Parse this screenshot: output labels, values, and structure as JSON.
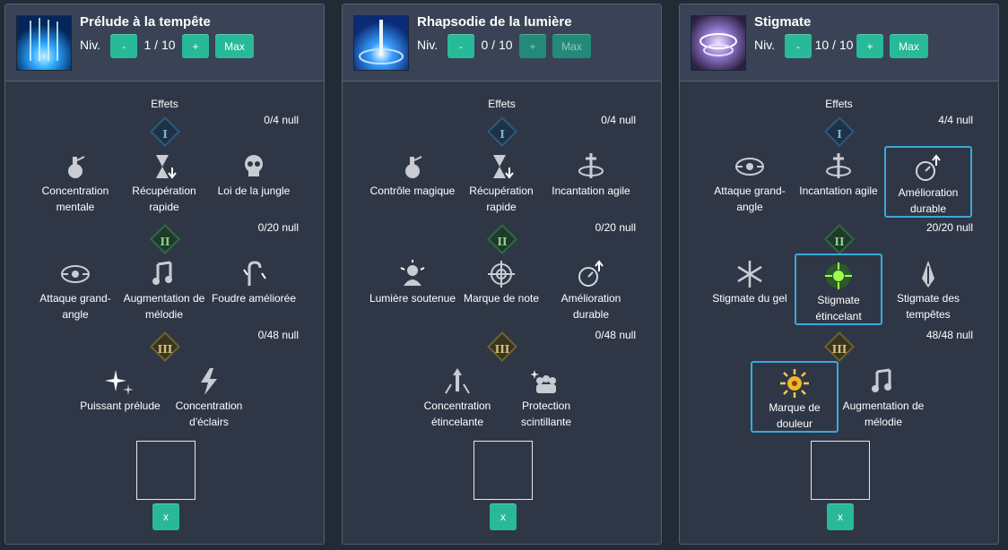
{
  "level_label": "Niv.",
  "minus_label": "-",
  "plus_label": "+",
  "max_label": "Max",
  "effects_label": "Effets",
  "remove_label": "x",
  "colors": {
    "button": "#28b998",
    "selected_border": "#3aa9d9",
    "panel": "#2f3747"
  },
  "panels": [
    {
      "title": "Prélude à la tempête",
      "level": "1 / 10",
      "counts": [
        "0/4 null",
        "0/20 null",
        "0/48 null"
      ],
      "tier1": [
        {
          "label": "Concentration mentale",
          "icon": "potion-icon"
        },
        {
          "label": "Récupération rapide",
          "icon": "hourglass-icon"
        },
        {
          "label": "Loi de la jungle",
          "icon": "skull-icon"
        }
      ],
      "tier2": [
        {
          "label": "Attaque grand-angle",
          "icon": "wide-eye-icon"
        },
        {
          "label": "Augmentation de mélodie",
          "icon": "music-note-icon"
        },
        {
          "label": "Foudre améliorée",
          "icon": "lightning-cane-icon"
        }
      ],
      "tier3": [
        {
          "label": "Puissant prélude",
          "icon": "sparkle-icon"
        },
        {
          "label": "Concentration d'éclairs",
          "icon": "lightning-icon"
        }
      ]
    },
    {
      "title": "Rhapsodie de la lumière",
      "level": "0 / 10",
      "counts": [
        "0/4 null",
        "0/20 null",
        "0/48 null"
      ],
      "tier1": [
        {
          "label": "Contrôle magique",
          "icon": "potion-icon"
        },
        {
          "label": "Récupération rapide",
          "icon": "hourglass-icon"
        },
        {
          "label": "Incantation agile",
          "icon": "sword-swirl-icon"
        }
      ],
      "tier2": [
        {
          "label": "Lumière soutenue",
          "icon": "sun-figure-icon"
        },
        {
          "label": "Marque de note",
          "icon": "target-icon"
        },
        {
          "label": "Amélioration durable",
          "icon": "stopwatch-up-icon"
        }
      ],
      "tier3": [
        {
          "label": "Concentration étincelante",
          "icon": "burst-up-icon"
        },
        {
          "label": "Protection scintillante",
          "icon": "group-sparkle-icon"
        }
      ]
    },
    {
      "title": "Stigmate",
      "level": "10 / 10",
      "counts": [
        "4/4 null",
        "20/20 null",
        "48/48 null"
      ],
      "tier1": [
        {
          "label": "Attaque grand-angle",
          "icon": "wide-eye-icon"
        },
        {
          "label": "Incantation agile",
          "icon": "sword-swirl-icon"
        },
        {
          "label": "Amélioration durable",
          "icon": "stopwatch-up-icon",
          "selected": true
        }
      ],
      "tier2": [
        {
          "label": "Stigmate du gel",
          "icon": "snowflake-icon"
        },
        {
          "label": "Stigmate étincelant",
          "icon": "green-burst-icon",
          "selected": true
        },
        {
          "label": "Stigmate des tempêtes",
          "icon": "storm-crystal-icon"
        }
      ],
      "tier3": [
        {
          "label": "Marque de douleur",
          "icon": "sun-mark-icon",
          "selected": true
        },
        {
          "label": "Augmentation de mélodie",
          "icon": "music-note-icon"
        }
      ]
    }
  ]
}
